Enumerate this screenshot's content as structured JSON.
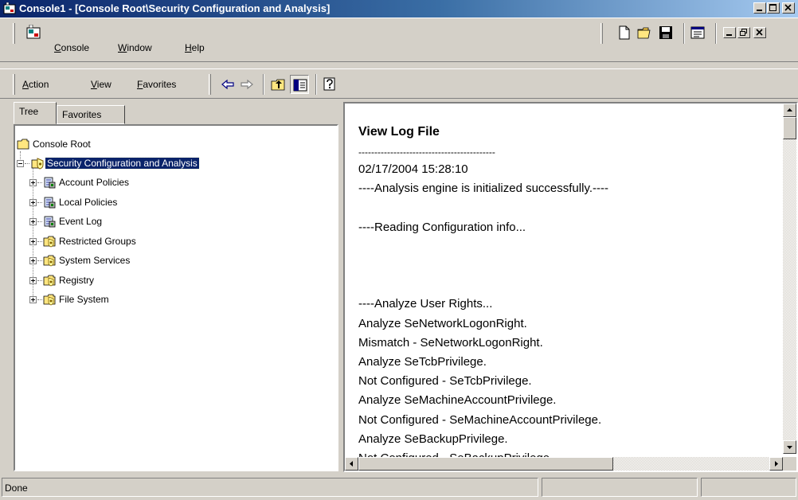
{
  "window": {
    "title": "Console1 - [Console Root\\Security Configuration and Analysis]"
  },
  "menubar": {
    "items": [
      {
        "label_u": "C",
        "label_rest": "onsole"
      },
      {
        "label_u": "W",
        "label_rest": "indow"
      },
      {
        "label_u": "H",
        "label_rest": "elp"
      }
    ]
  },
  "toolbar": {
    "items": [
      {
        "label_u": "A",
        "label_rest": "ction"
      },
      {
        "label_u": "V",
        "label_rest": "iew"
      },
      {
        "label_u": "F",
        "label_rest": "avorites"
      }
    ]
  },
  "tabs": [
    {
      "label": "Tree"
    },
    {
      "label": "Favorites"
    }
  ],
  "tree": {
    "root": "Console Root",
    "selected": "Security Configuration and Analysis",
    "children": [
      {
        "label": "Account Policies",
        "icon": "policy-icon"
      },
      {
        "label": "Local Policies",
        "icon": "policy-icon"
      },
      {
        "label": "Event Log",
        "icon": "policy-icon"
      },
      {
        "label": "Restricted Groups",
        "icon": "secure-folder-icon"
      },
      {
        "label": "System Services",
        "icon": "secure-folder-icon"
      },
      {
        "label": "Registry",
        "icon": "secure-folder-icon"
      },
      {
        "label": "File System",
        "icon": "secure-folder-icon"
      }
    ]
  },
  "log": {
    "heading": "View Log File",
    "separator": "-------------------------------------------",
    "lines": [
      "02/17/2004 15:28:10",
      "----Analysis engine is initialized successfully.----",
      "",
      "----Reading Configuration info...",
      "",
      "",
      "",
      "----Analyze User Rights...",
      "Analyze SeNetworkLogonRight.",
      "Mismatch - SeNetworkLogonRight.",
      "Analyze SeTcbPrivilege.",
      "Not Configured - SeTcbPrivilege.",
      "Analyze SeMachineAccountPrivilege.",
      "Not Configured - SeMachineAccountPrivilege.",
      "Analyze SeBackupPrivilege.",
      "Not Configured - SeBackupPrivilege."
    ]
  },
  "status": {
    "text": "Done"
  },
  "colors": {
    "titlebar": "#0a246a",
    "selection": "#0a246a",
    "face": "#d4d0c8"
  }
}
